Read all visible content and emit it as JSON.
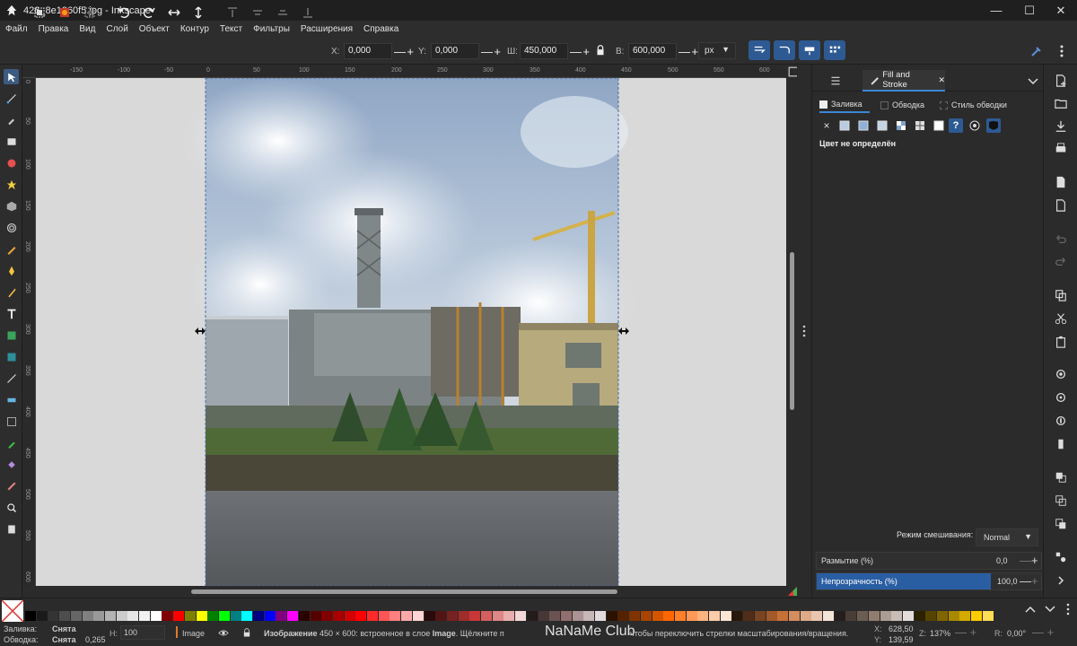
{
  "window": {
    "title": "426_8e1260f5.jpg - Inkscape",
    "minimize": "—",
    "maximize": "☐",
    "close": "✕"
  },
  "menu": [
    "Файл",
    "Правка",
    "Вид",
    "Слой",
    "Объект",
    "Контур",
    "Текст",
    "Фильтры",
    "Расширения",
    "Справка"
  ],
  "toolbar": {
    "x_label": "X:",
    "x_value": "0,000",
    "y_label": "Y:",
    "y_value": "0,000",
    "w_label": "Ш:",
    "w_value": "450,000",
    "h_label": "В:",
    "h_value": "600,000",
    "unit": "px",
    "minus": "—",
    "plus": "+"
  },
  "ruler": {
    "h_labels": [
      "-150",
      "-100",
      "-50",
      "0",
      "50",
      "100",
      "150",
      "200",
      "250",
      "300",
      "350",
      "400",
      "450",
      "500",
      "550",
      "600"
    ],
    "v_labels": [
      "0",
      "50",
      "100",
      "150",
      "200",
      "250",
      "300",
      "350",
      "400",
      "450",
      "500",
      "550",
      "600"
    ]
  },
  "dock": {
    "tab_label": "Fill and Stroke",
    "tab_close": "✕",
    "subtabs": [
      "Заливка",
      "Обводка",
      "Стиль обводки"
    ],
    "no_paint": "×",
    "unknown_paint": "?",
    "fill_note": "Цвет не определён",
    "blend_label": "Режим смешивания:",
    "blend_value": "Normal",
    "blur_label": "Размытие (%)",
    "blur_value": "0,0",
    "opacity_label": "Непрозрачность (%)",
    "opacity_value": "100,0",
    "opacity_fraction": 1.0
  },
  "status": {
    "fill_label": "Заливка:",
    "fill_value": "Снята",
    "stroke_label": "Обводка:",
    "stroke_value": "Снята",
    "stroke_width": "0,265",
    "h_label": "H:",
    "h_value": "100",
    "layer": "Image",
    "message_bold": "Изображение",
    "message_a": " 450 × 600: встроенное в слое ",
    "message_layer": "Image",
    "message_b": ". Щёлкните п",
    "message_c": "чтобы переключить стрелки масштабирования/вращения.",
    "watermark": "NaNaMe Club",
    "x_label": "X:",
    "x_value": "628,50",
    "y_label": "Y:",
    "y_value": "139,59",
    "z_label": "Z:",
    "z_value": "137%",
    "r_label": "R:",
    "r_value": "0,00°"
  },
  "colors": {
    "accent": "#3d86d6",
    "opacity_fill": "#2a5ea3",
    "snap_active": "#2e5a93"
  },
  "palette": [
    "#000000",
    "#1a1a1a",
    "#333333",
    "#4d4d4d",
    "#666666",
    "#808080",
    "#999999",
    "#b3b3b3",
    "#cccccc",
    "#e6e6e6",
    "#f2f2f2",
    "#ffffff",
    "#800000",
    "#ff0000",
    "#808000",
    "#ffff00",
    "#008000",
    "#00ff00",
    "#008080",
    "#00ffff",
    "#000080",
    "#0000ff",
    "#800080",
    "#ff00ff",
    "#2b0000",
    "#550000",
    "#800000",
    "#aa0000",
    "#d40000",
    "#ff0000",
    "#ff2a2a",
    "#ff5555",
    "#ff8080",
    "#ffaaaa",
    "#ffd5d5",
    "#280b0b",
    "#501616",
    "#782121",
    "#a02c2c",
    "#c83737",
    "#d35f5f",
    "#de8787",
    "#e9afaf",
    "#f4d7d7",
    "#241c1c",
    "#483737",
    "#6c5353",
    "#916f6f",
    "#ac9393",
    "#c8b7b7",
    "#e3dbdb",
    "#2b1100",
    "#552200",
    "#803300",
    "#aa4400",
    "#d45500",
    "#ff6600",
    "#ff7f2a",
    "#ff9955",
    "#ffb380",
    "#ffccaa",
    "#ffe6d5",
    "#28170b",
    "#502d16",
    "#784421",
    "#a05a2c",
    "#c87137",
    "#d38d5f",
    "#deaa87",
    "#e9c6af",
    "#f4e3d7",
    "#241f1c",
    "#483e37",
    "#6c5d53",
    "#917c6f",
    "#ac9d93",
    "#c8beb7",
    "#e3dedb",
    "#2b2200",
    "#554400",
    "#806600",
    "#aa8800",
    "#d4aa00",
    "#ffcc00",
    "#ffdd55"
  ]
}
